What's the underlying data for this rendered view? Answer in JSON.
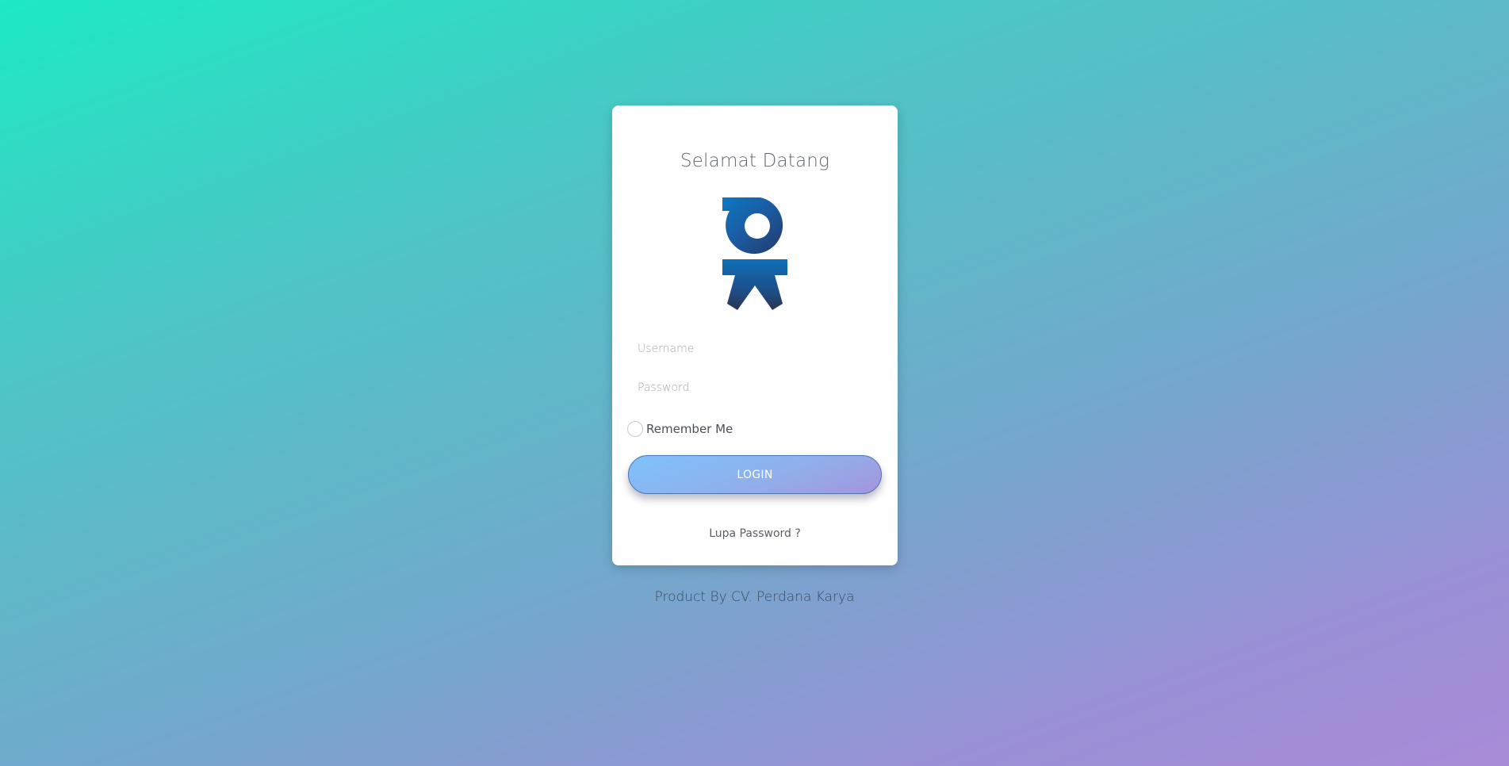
{
  "login_card": {
    "title": "Selamat Datang",
    "logo": "ok-logo",
    "username_placeholder": "Username",
    "password_placeholder": "Password",
    "remember_label": "Remember Me",
    "login_label": "LOGIN",
    "forgot_label": "Lupa Password ?"
  },
  "footer": {
    "text": "Product By CV. Perdana Karya"
  },
  "colors": {
    "background_gradient": [
      "#1de9c3",
      "#4fc4c6",
      "#72a9cc",
      "#9a8fd6",
      "#a98cd8"
    ],
    "button_gradient": [
      "#7ec2fb",
      "#8fb0ec",
      "#a794de"
    ],
    "logo_blue": "#1e5a9c"
  }
}
